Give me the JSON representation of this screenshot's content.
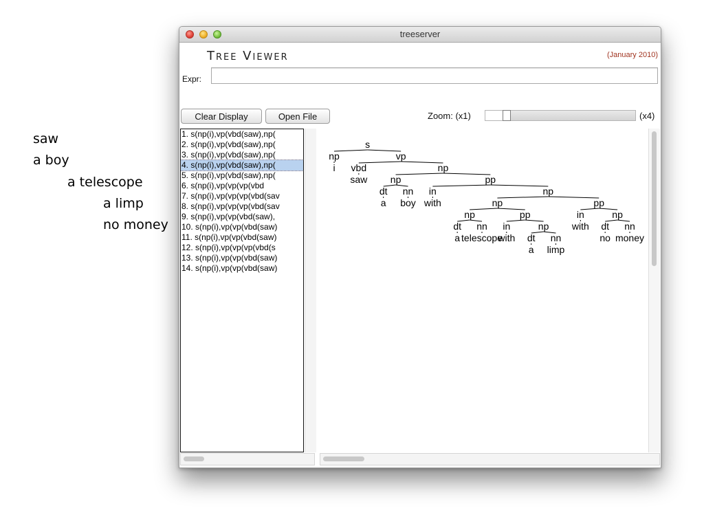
{
  "side_notes": [
    "saw",
    "a boy",
    "a telescope",
    "a limp",
    "no money"
  ],
  "window": {
    "title": "treeserver",
    "app_title": "Tree Viewer",
    "date": "(January 2010)"
  },
  "expr": {
    "label": "Expr:",
    "value": "",
    "placeholder": ""
  },
  "toolbar": {
    "clear_label": "Clear Display",
    "open_label": "Open File",
    "zoom_label": "Zoom: (x1)",
    "zoom_max_label": "(x4)",
    "zoom_fraction": 0.12
  },
  "list": {
    "selected_index": 3,
    "items": [
      "1. s(np(i),vp(vbd(saw),np(",
      "2. s(np(i),vp(vbd(saw),np(",
      "3. s(np(i),vp(vbd(saw),np(",
      "4. s(np(i),vp(vbd(saw),np(",
      "5. s(np(i),vp(vbd(saw),np(",
      "6. s(np(i),vp(vp(vp(vbd",
      "7. s(np(i),vp(vp(vp(vbd(sav",
      "8. s(np(i),vp(vp(vp(vbd(sav",
      "9. s(np(i),vp(vp(vbd(saw),",
      "10. s(np(i),vp(vp(vbd(saw)",
      "11. s(np(i),vp(vp(vbd(saw)",
      "12. s(np(i),vp(vp(vp(vbd(s",
      "13. s(np(i),vp(vp(vbd(saw)",
      "14. s(np(i),vp(vp(vbd(saw)"
    ]
  },
  "tree": {
    "label": "s",
    "children": [
      {
        "label": "np",
        "children": [
          {
            "label": "i"
          }
        ]
      },
      {
        "label": "vp",
        "children": [
          {
            "label": "vbd",
            "children": [
              {
                "label": "saw"
              }
            ]
          },
          {
            "label": "np",
            "children": [
              {
                "label": "np",
                "children": [
                  {
                    "label": "dt",
                    "children": [
                      {
                        "label": "a"
                      }
                    ]
                  },
                  {
                    "label": "nn",
                    "children": [
                      {
                        "label": "boy"
                      }
                    ]
                  }
                ]
              },
              {
                "label": "pp",
                "children": [
                  {
                    "label": "in",
                    "children": [
                      {
                        "label": "with"
                      }
                    ]
                  },
                  {
                    "label": "np",
                    "children": [
                      {
                        "label": "np",
                        "children": [
                          {
                            "label": "np",
                            "children": [
                              {
                                "label": "dt",
                                "children": [
                                  {
                                    "label": "a"
                                  }
                                ]
                              },
                              {
                                "label": "nn",
                                "children": [
                                  {
                                    "label": "telescope"
                                  }
                                ]
                              }
                            ]
                          },
                          {
                            "label": "pp",
                            "children": [
                              {
                                "label": "in",
                                "children": [
                                  {
                                    "label": "with"
                                  }
                                ]
                              },
                              {
                                "label": "np",
                                "children": [
                                  {
                                    "label": "dt",
                                    "children": [
                                      {
                                        "label": "a"
                                      }
                                    ]
                                  },
                                  {
                                    "label": "nn",
                                    "children": [
                                      {
                                        "label": "limp"
                                      }
                                    ]
                                  }
                                ]
                              }
                            ]
                          }
                        ]
                      },
                      {
                        "label": "pp",
                        "children": [
                          {
                            "label": "in",
                            "children": [
                              {
                                "label": "with"
                              }
                            ]
                          },
                          {
                            "label": "np",
                            "children": [
                              {
                                "label": "dt",
                                "children": [
                                  {
                                    "label": "no"
                                  }
                                ]
                              },
                              {
                                "label": "nn",
                                "children": [
                                  {
                                    "label": "money"
                                  }
                                ]
                              }
                            ]
                          }
                        ]
                      }
                    ]
                  }
                ]
              }
            ]
          }
        ]
      }
    ]
  }
}
